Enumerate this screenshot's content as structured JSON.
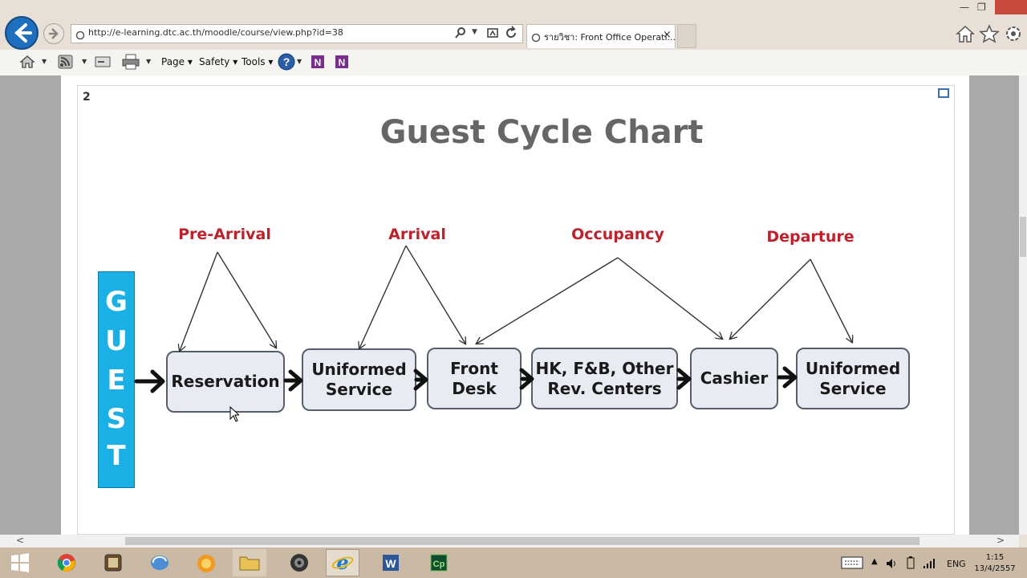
{
  "browser": {
    "url": "http://e-learning.dtc.ac.th/moodle/course/view.php?id=38",
    "tab_title": "รายวิชา: Front Office Operati...",
    "tab_close": "×",
    "commands": {
      "page": "Page",
      "safety": "Safety",
      "tools": "Tools"
    }
  },
  "slide": {
    "number": "2",
    "title": "Guest Cycle Chart",
    "guest_letters": [
      "G",
      "U",
      "E",
      "S",
      "T"
    ],
    "phases": [
      "Pre-Arrival",
      "Arrival",
      "Occupancy",
      "Departure"
    ],
    "steps": [
      "Reservation",
      "Uniformed\nService",
      "Front\nDesk",
      "HK, F&B, Other\nRev. Centers",
      "Cashier",
      "Uniformed\nService"
    ]
  },
  "colors": {
    "phase_text": "#c0202a",
    "guest_bar": "#1ab0e6",
    "box_fill": "#e8ebf1",
    "title_text": "#666666"
  },
  "taskbar": {
    "icons": [
      "windows-start-icon",
      "chrome-icon",
      "app-icon",
      "sync-icon",
      "app-icon-orange",
      "file-explorer-icon",
      "speaker-app-icon",
      "internet-explorer-icon",
      "word-icon",
      "captivate-icon"
    ],
    "language": "ENG",
    "time": "1:15",
    "date": "13/4/2557"
  },
  "scroll": {
    "left_arrow": "<",
    "right_arrow": ">"
  }
}
